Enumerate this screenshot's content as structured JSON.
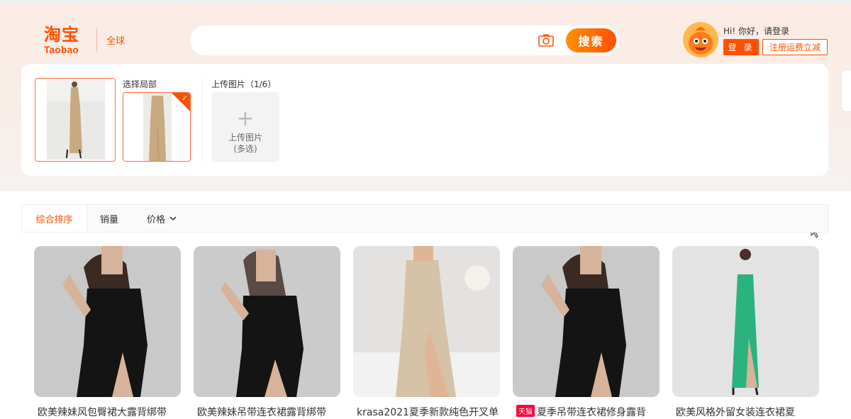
{
  "header": {
    "logo_cn": "淘宝",
    "logo_en": "Taobao",
    "region": "全球",
    "search": {
      "placeholder": "",
      "button_label": "搜索"
    },
    "user": {
      "greeting": "Hi! 你好，请登录",
      "login_label": "登 录",
      "register_label": "注册运费立减"
    }
  },
  "image_search": {
    "select_region_label": "选择局部",
    "upload_label": "上传图片（1/6）",
    "upload_box": {
      "plus": "+",
      "line1": "上传图片",
      "line2": "(多选)"
    }
  },
  "sort": {
    "items": [
      "综合排序",
      "销量",
      "价格"
    ],
    "active": "综合排序"
  },
  "products": [
    {
      "title": "欧美辣妹风包臀裙大露背绑带",
      "tmall": false,
      "dress_color": "#141414",
      "bg": "#c9c9c9"
    },
    {
      "title": "欧美辣妹吊带连衣裙露背绑带",
      "tmall": false,
      "dress_color": "#141414",
      "bg": "#cbcbcb"
    },
    {
      "title": "krasa2021夏季新款纯色开叉单",
      "tmall": false,
      "dress_color": "#d6c2a6",
      "bg": "#e4e2e0"
    },
    {
      "title": "夏季吊带连衣裙修身露背",
      "tmall": true,
      "tmall_label": "天猫",
      "dress_color": "#141414",
      "bg": "#c9c9c9"
    },
    {
      "title": "欧美风格外留女装连衣裙夏",
      "tmall": false,
      "dress_color": "#2bb37f",
      "bg": "#e3e3e3"
    }
  ],
  "colors": {
    "accent": "#ff5000",
    "accent_light": "#ff9000",
    "tmall": "#ff0036"
  }
}
